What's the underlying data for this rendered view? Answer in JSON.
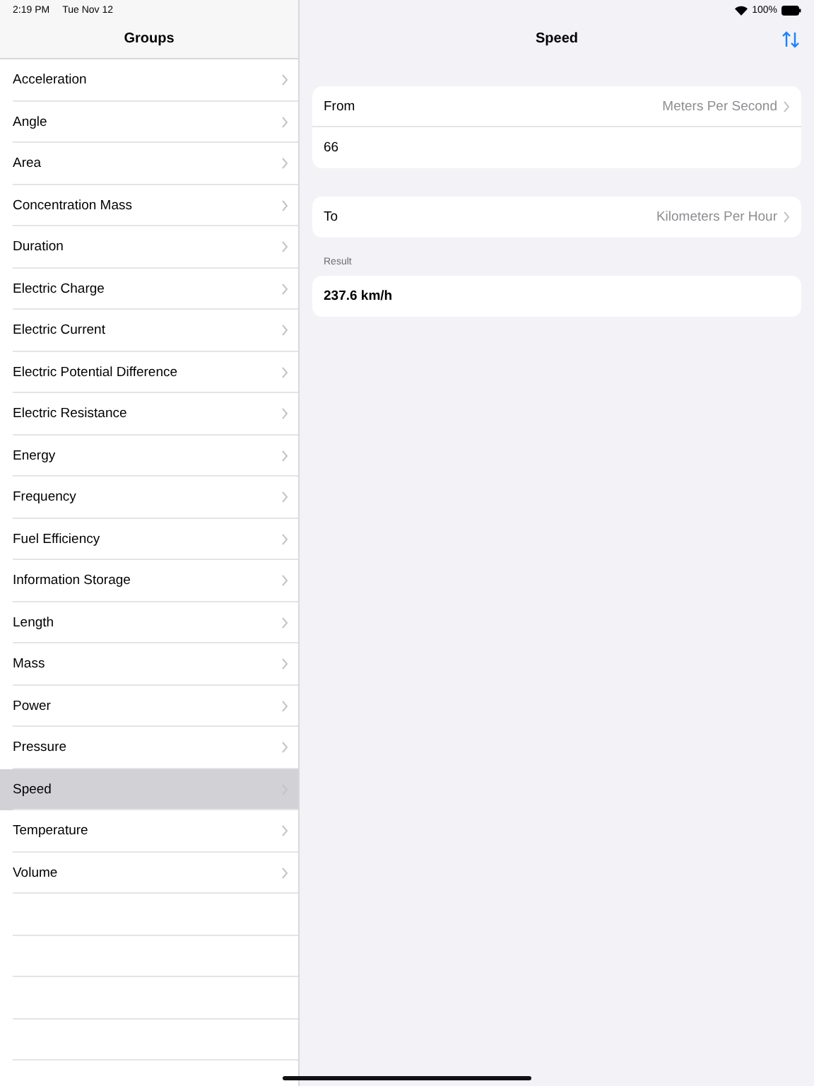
{
  "status_bar": {
    "time": "2:19 PM",
    "date": "Tue Nov 12",
    "battery": "100%"
  },
  "sidebar": {
    "title": "Groups",
    "items": [
      {
        "label": "Acceleration",
        "selected": false
      },
      {
        "label": "Angle",
        "selected": false
      },
      {
        "label": "Area",
        "selected": false
      },
      {
        "label": "Concentration Mass",
        "selected": false
      },
      {
        "label": "Duration",
        "selected": false
      },
      {
        "label": "Electric Charge",
        "selected": false
      },
      {
        "label": "Electric Current",
        "selected": false
      },
      {
        "label": "Electric Potential Difference",
        "selected": false
      },
      {
        "label": "Electric Resistance",
        "selected": false
      },
      {
        "label": "Energy",
        "selected": false
      },
      {
        "label": "Frequency",
        "selected": false
      },
      {
        "label": "Fuel Efficiency",
        "selected": false
      },
      {
        "label": "Information Storage",
        "selected": false
      },
      {
        "label": "Length",
        "selected": false
      },
      {
        "label": "Mass",
        "selected": false
      },
      {
        "label": "Power",
        "selected": false
      },
      {
        "label": "Pressure",
        "selected": false
      },
      {
        "label": "Speed",
        "selected": true
      },
      {
        "label": "Temperature",
        "selected": false
      },
      {
        "label": "Volume",
        "selected": false
      }
    ]
  },
  "detail": {
    "title": "Speed",
    "from": {
      "label": "From",
      "unit": "Meters Per Second",
      "value": "66"
    },
    "to": {
      "label": "To",
      "unit": "Kilometers Per Hour"
    },
    "result": {
      "label": "Result",
      "value": "237.6 km/h"
    }
  }
}
